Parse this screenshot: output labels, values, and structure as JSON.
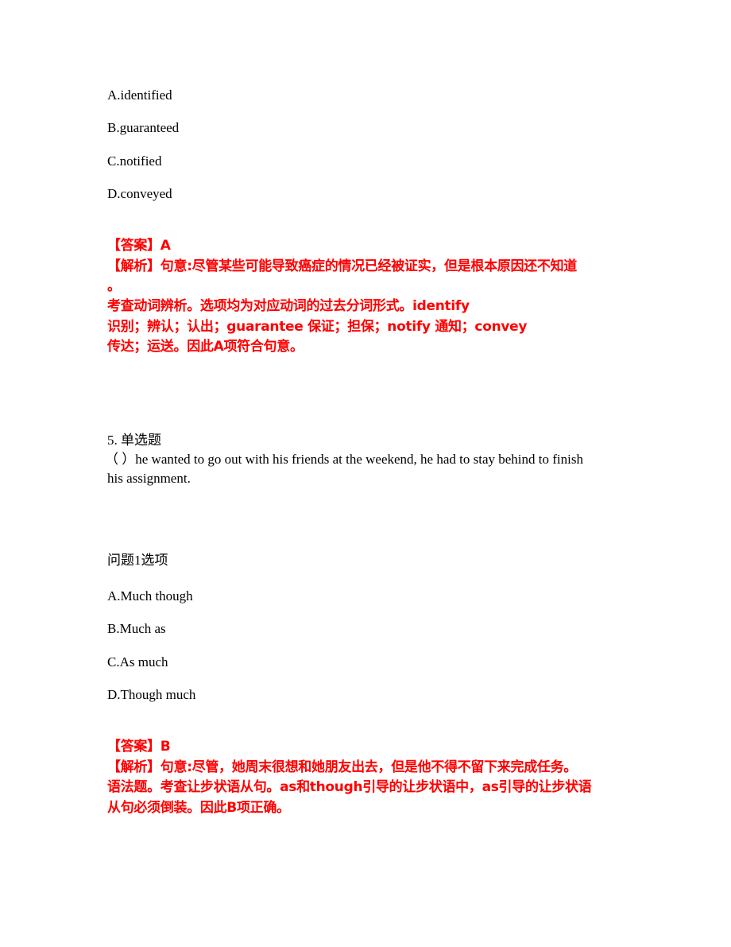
{
  "question4": {
    "options": [
      "A.identified",
      "B.guaranteed",
      "C.notified",
      "D.conveyed"
    ],
    "answer_label": "【答案】A",
    "analysis_lines": [
      "【解析】句意:尽管某些可能导致癌症的情况已经被证实，但是根本原因还不知道",
      "。",
      "考查动词辨析。选项均为对应动词的过去分词形式。identify",
      "识别；辨认；认出；guarantee 保证；担保；notify 通知；convey",
      "传达；运送。因此A项符合句意。"
    ]
  },
  "question5": {
    "header": "5. 单选题",
    "stem_lines": [
      "（ ）he wanted to go out with his friends at the weekend, he had to stay behind to finish",
      "his assignment."
    ],
    "options_title": "问题1选项",
    "options": [
      "A.Much though",
      "B.Much as",
      "C.As much",
      "D.Though much"
    ],
    "answer_label": "【答案】B",
    "analysis_lines": [
      "【解析】句意:尽管，她周末很想和她朋友出去，但是他不得不留下来完成任务。",
      "语法题。考查让步状语从句。as和though引导的让步状语中，as引导的让步状语",
      "从句必须倒装。因此B项正确。"
    ]
  },
  "colors": {
    "text": "#000000",
    "answer_red": "#ff0000",
    "background": "#ffffff"
  }
}
